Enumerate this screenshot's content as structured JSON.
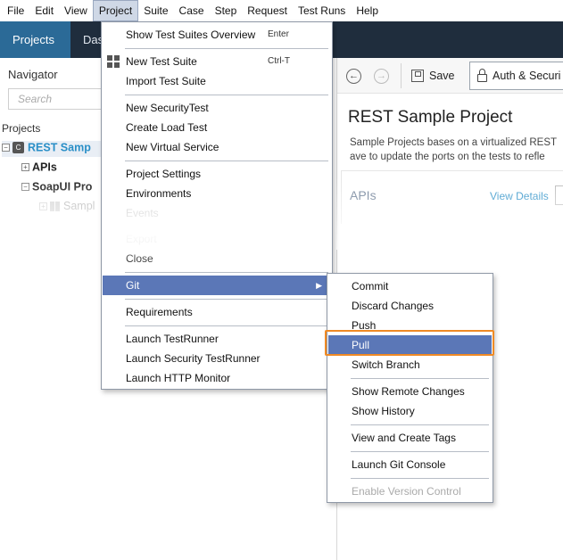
{
  "menubar": {
    "items": [
      "File",
      "Edit",
      "View",
      "Project",
      "Suite",
      "Case",
      "Step",
      "Request",
      "Test Runs",
      "Help"
    ],
    "active": "Project"
  },
  "topbar": {
    "tab_projects": "Projects",
    "tab_dashboard": "Das"
  },
  "navigator": {
    "title": "Navigator",
    "search_placeholder": "Search",
    "projects_label": "Projects",
    "tree": {
      "project_icon_letter": "C",
      "rest_project": "REST Samp",
      "apis": "APIs",
      "soapui_project": "SoapUI Pro",
      "sample": "Sampl"
    }
  },
  "rightpanel": {
    "save_label": "Save",
    "auth_label": "Auth & Securi",
    "project_title": "REST Sample Project",
    "description_lines": [
      "Sample Projects bases on a virtualized REST",
      "ave to update the ports on the tests to refle"
    ],
    "apis_title": "APIs",
    "view_details": "View Details"
  },
  "project_menu": {
    "items": [
      {
        "label": "Show Test Suites Overview",
        "shortcut": "Enter"
      },
      {
        "label": "New Test Suite",
        "shortcut": "Ctrl-T"
      },
      {
        "label": "Import Test Suite"
      },
      {
        "label": "New SecurityTest"
      },
      {
        "label": "Create Load Test"
      },
      {
        "label": "New Virtual Service"
      },
      {
        "label": "Project Settings"
      },
      {
        "label": "Environments"
      },
      {
        "label": "Events"
      },
      {
        "label": "Export"
      },
      {
        "label": "Close"
      },
      {
        "label": "Git"
      },
      {
        "label": "Requirements"
      },
      {
        "label": "Launch TestRunner"
      },
      {
        "label": "Launch Security TestRunner"
      },
      {
        "label": "Launch HTTP Monitor"
      }
    ]
  },
  "git_menu": {
    "items": [
      {
        "label": "Commit"
      },
      {
        "label": "Discard Changes"
      },
      {
        "label": "Push"
      },
      {
        "label": "Pull"
      },
      {
        "label": "Switch Branch"
      },
      {
        "label": "Show Remote Changes"
      },
      {
        "label": "Show History"
      },
      {
        "label": "View and Create Tags"
      },
      {
        "label": "Launch Git Console"
      },
      {
        "label": "Enable Version Control"
      }
    ]
  },
  "colors": {
    "highlight": "#5b77b7",
    "callout_outline": "#f08a24",
    "topbar": "#1f2d3d",
    "projects_tab": "#2b6a97",
    "link": "#2a8fc7"
  }
}
